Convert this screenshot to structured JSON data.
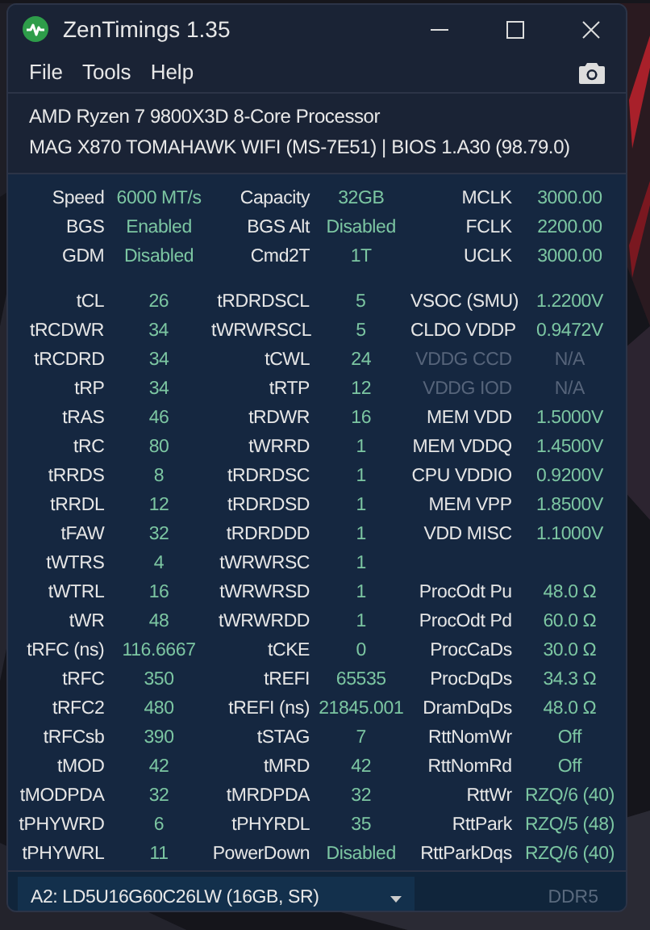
{
  "window": {
    "title": "ZenTimings 1.35"
  },
  "menu": [
    "File",
    "Tools",
    "Help"
  ],
  "system": {
    "cpu": "AMD Ryzen 7 9800X3D 8-Core Processor",
    "board": "MAG X870 TOMAHAWK WIFI (MS-7E51) | BIOS 1.A30 (98.79.0)"
  },
  "summary_rows": [
    {
      "cells": [
        {
          "label": "Speed",
          "value": "6000 MT/s",
          "disabled": false
        },
        {
          "label": "Capacity",
          "value": "32GB",
          "disabled": false
        },
        {
          "label": "MCLK",
          "value": "3000.00",
          "disabled": false
        }
      ]
    },
    {
      "cells": [
        {
          "label": "BGS",
          "value": "Enabled",
          "disabled": false
        },
        {
          "label": "BGS Alt",
          "value": "Disabled",
          "disabled": false
        },
        {
          "label": "FCLK",
          "value": "2200.00",
          "disabled": false
        }
      ]
    },
    {
      "cells": [
        {
          "label": "GDM",
          "value": "Disabled",
          "disabled": false
        },
        {
          "label": "Cmd2T",
          "value": "1T",
          "disabled": false
        },
        {
          "label": "UCLK",
          "value": "3000.00",
          "disabled": false
        }
      ]
    }
  ],
  "timing_rows": [
    {
      "cells": [
        {
          "label": "tCL",
          "value": "26",
          "disabled": false
        },
        {
          "label": "tRDRDSCL",
          "value": "5",
          "disabled": false
        },
        {
          "label": "VSOC (SMU)",
          "value": "1.2200V",
          "disabled": false
        }
      ]
    },
    {
      "cells": [
        {
          "label": "tRCDWR",
          "value": "34",
          "disabled": false
        },
        {
          "label": "tWRWRSCL",
          "value": "5",
          "disabled": false
        },
        {
          "label": "CLDO VDDP",
          "value": "0.9472V",
          "disabled": false
        }
      ]
    },
    {
      "cells": [
        {
          "label": "tRCDRD",
          "value": "34",
          "disabled": false
        },
        {
          "label": "tCWL",
          "value": "24",
          "disabled": false
        },
        {
          "label": "VDDG CCD",
          "value": "N/A",
          "disabled": true
        }
      ]
    },
    {
      "cells": [
        {
          "label": "tRP",
          "value": "34",
          "disabled": false
        },
        {
          "label": "tRTP",
          "value": "12",
          "disabled": false
        },
        {
          "label": "VDDG IOD",
          "value": "N/A",
          "disabled": true
        }
      ]
    },
    {
      "cells": [
        {
          "label": "tRAS",
          "value": "46",
          "disabled": false
        },
        {
          "label": "tRDWR",
          "value": "16",
          "disabled": false
        },
        {
          "label": "MEM VDD",
          "value": "1.5000V",
          "disabled": false
        }
      ]
    },
    {
      "cells": [
        {
          "label": "tRC",
          "value": "80",
          "disabled": false
        },
        {
          "label": "tWRRD",
          "value": "1",
          "disabled": false
        },
        {
          "label": "MEM VDDQ",
          "value": "1.4500V",
          "disabled": false
        }
      ]
    },
    {
      "cells": [
        {
          "label": "tRRDS",
          "value": "8",
          "disabled": false
        },
        {
          "label": "tRDRDSC",
          "value": "1",
          "disabled": false
        },
        {
          "label": "CPU VDDIO",
          "value": "0.9200V",
          "disabled": false
        }
      ]
    },
    {
      "cells": [
        {
          "label": "tRRDL",
          "value": "12",
          "disabled": false
        },
        {
          "label": "tRDRDSD",
          "value": "1",
          "disabled": false
        },
        {
          "label": "MEM VPP",
          "value": "1.8500V",
          "disabled": false
        }
      ]
    },
    {
      "cells": [
        {
          "label": "tFAW",
          "value": "32",
          "disabled": false
        },
        {
          "label": "tRDRDDD",
          "value": "1",
          "disabled": false
        },
        {
          "label": "VDD MISC",
          "value": "1.1000V",
          "disabled": false
        }
      ]
    },
    {
      "cells": [
        {
          "label": "tWTRS",
          "value": "4",
          "disabled": false
        },
        {
          "label": "tWRWRSC",
          "value": "1",
          "disabled": false
        }
      ]
    },
    {
      "cells": [
        {
          "label": "tWTRL",
          "value": "16",
          "disabled": false
        },
        {
          "label": "tWRWRSD",
          "value": "1",
          "disabled": false
        },
        {
          "label": "ProcOdt Pu",
          "value": "48.0 Ω",
          "disabled": false
        }
      ]
    },
    {
      "cells": [
        {
          "label": "tWR",
          "value": "48",
          "disabled": false
        },
        {
          "label": "tWRWRDD",
          "value": "1",
          "disabled": false
        },
        {
          "label": "ProcOdt Pd",
          "value": "60.0 Ω",
          "disabled": false
        }
      ]
    },
    {
      "cells": [
        {
          "label": "tRFC (ns)",
          "value": "116.6667",
          "disabled": false
        },
        {
          "label": "tCKE",
          "value": "0",
          "disabled": false
        },
        {
          "label": "ProcCaDs",
          "value": "30.0 Ω",
          "disabled": false
        }
      ]
    },
    {
      "cells": [
        {
          "label": "tRFC",
          "value": "350",
          "disabled": false
        },
        {
          "label": "tREFI",
          "value": "65535",
          "disabled": false
        },
        {
          "label": "ProcDqDs",
          "value": "34.3 Ω",
          "disabled": false
        }
      ]
    },
    {
      "cells": [
        {
          "label": "tRFC2",
          "value": "480",
          "disabled": false
        },
        {
          "label": "tREFI (ns)",
          "value": "21845.001",
          "disabled": false
        },
        {
          "label": "DramDqDs",
          "value": "48.0 Ω",
          "disabled": false
        }
      ]
    },
    {
      "cells": [
        {
          "label": "tRFCsb",
          "value": "390",
          "disabled": false
        },
        {
          "label": "tSTAG",
          "value": "7",
          "disabled": false
        },
        {
          "label": "RttNomWr",
          "value": "Off",
          "disabled": false
        }
      ]
    },
    {
      "cells": [
        {
          "label": "tMOD",
          "value": "42",
          "disabled": false
        },
        {
          "label": "tMRD",
          "value": "42",
          "disabled": false
        },
        {
          "label": "RttNomRd",
          "value": "Off",
          "disabled": false
        }
      ]
    },
    {
      "cells": [
        {
          "label": "tMODPDA",
          "value": "32",
          "disabled": false
        },
        {
          "label": "tMRDPDA",
          "value": "32",
          "disabled": false
        },
        {
          "label": "RttWr",
          "value": "RZQ/6 (40)",
          "disabled": false
        }
      ]
    },
    {
      "cells": [
        {
          "label": "tPHYWRD",
          "value": "6",
          "disabled": false
        },
        {
          "label": "tPHYRDL",
          "value": "35",
          "disabled": false
        },
        {
          "label": "RttPark",
          "value": "RZQ/5 (48)",
          "disabled": false
        }
      ]
    },
    {
      "cells": [
        {
          "label": "tPHYWRL",
          "value": "11",
          "disabled": false
        },
        {
          "label": "PowerDown",
          "value": "Disabled",
          "disabled": false
        },
        {
          "label": "RttParkDqs",
          "value": "RZQ/6 (40)",
          "disabled": false
        }
      ]
    }
  ],
  "module_select": {
    "value": "A2: LD5U16G60C26LW (16GB, SR)"
  },
  "memory_type": "DDR5"
}
